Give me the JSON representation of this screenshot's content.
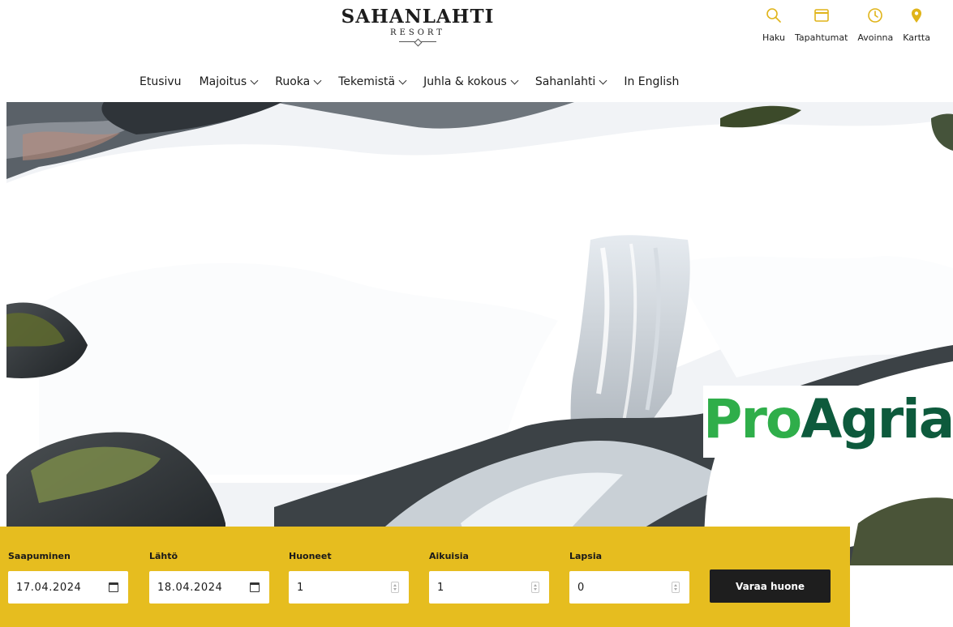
{
  "brand": {
    "name": "SAHANLAHTI",
    "sub": "RESORT"
  },
  "utilities": [
    {
      "label": "Haku",
      "icon": "search-icon"
    },
    {
      "label": "Tapahtumat",
      "icon": "calendar-icon"
    },
    {
      "label": "Avoinna",
      "icon": "clock-icon"
    },
    {
      "label": "Kartta",
      "icon": "map-pin-icon"
    }
  ],
  "nav": [
    {
      "label": "Etusivu",
      "dropdown": false
    },
    {
      "label": "Majoitus",
      "dropdown": true
    },
    {
      "label": "Ruoka",
      "dropdown": true
    },
    {
      "label": "Tekemistä",
      "dropdown": true
    },
    {
      "label": "Juhla & kokous",
      "dropdown": true
    },
    {
      "label": "Sahanlahti",
      "dropdown": true
    },
    {
      "label": "In English",
      "dropdown": false
    }
  ],
  "hero": {
    "logo": {
      "part1": "Pro",
      "part2": "Agria"
    }
  },
  "booking": {
    "arrival": {
      "label": "Saapuminen",
      "value": "17.04.2024"
    },
    "departure": {
      "label": "Lähtö",
      "value": "18.04.2024"
    },
    "rooms": {
      "label": "Huoneet",
      "value": "1"
    },
    "adults": {
      "label": "Aikuisia",
      "value": "1"
    },
    "children": {
      "label": "Lapsia",
      "value": "0"
    },
    "submit_label": "Varaa huone"
  },
  "colors": {
    "accent": "#e6bd1f",
    "button": "#1e1e1e",
    "icon": "#e0b419",
    "proagria_light": "#2fae4a",
    "proagria_dark": "#0d5a3c"
  }
}
